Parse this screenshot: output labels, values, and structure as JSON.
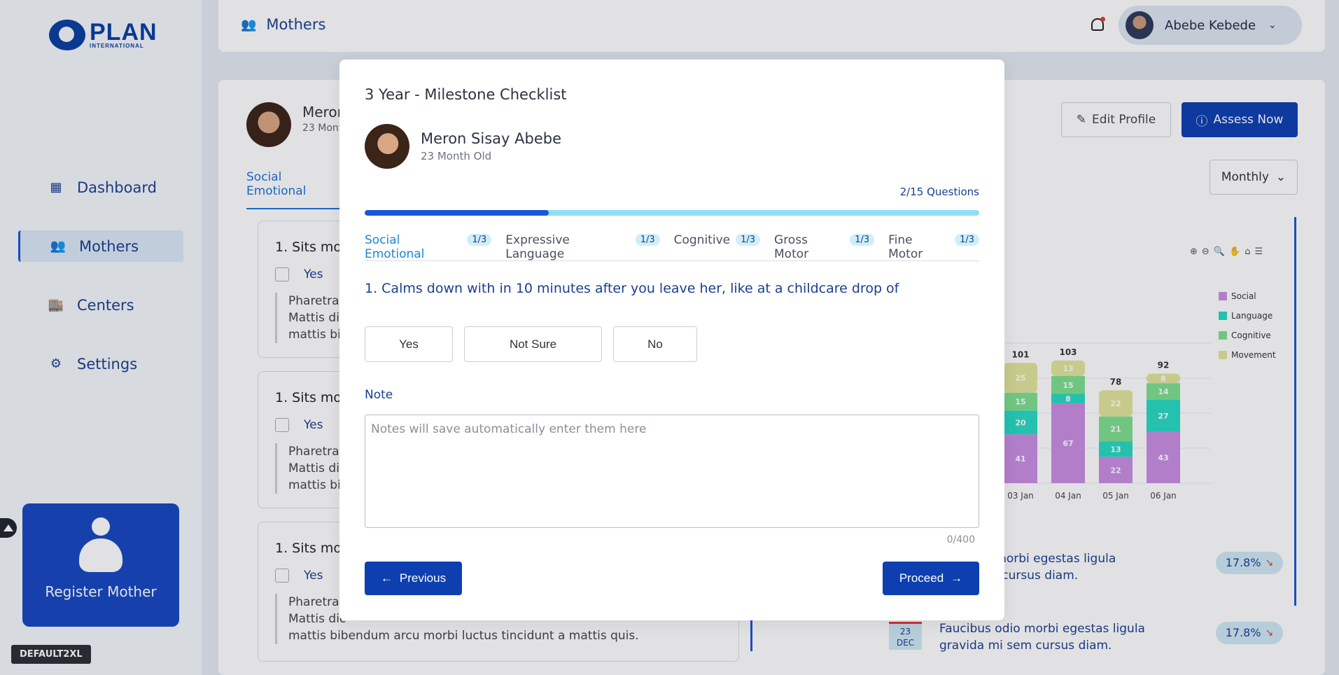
{
  "sidebar": {
    "logo": {
      "word": "PLAN",
      "sub": "INTERNATIONAL"
    },
    "items": [
      {
        "label": "Dashboard",
        "icon": "dashboard-icon"
      },
      {
        "label": "Mothers",
        "icon": "mothers-icon",
        "active": true
      },
      {
        "label": "Centers",
        "icon": "centers-icon"
      },
      {
        "label": "Settings",
        "icon": "gear-icon"
      }
    ],
    "register_label": "Register Mother",
    "env_tag": "DEFAULT2XL"
  },
  "header": {
    "title": "Mothers",
    "user_name": "Abebe Kebede"
  },
  "background": {
    "child_name": "Meron",
    "child_age": "23 Month",
    "active_tab": "Social Emotional",
    "questions": [
      {
        "title": "1. Sits mom",
        "yes": "Yes",
        "note": "Pharetra\nMattis dic\nmattis bil"
      },
      {
        "title": "1. Sits mom",
        "yes": "Yes",
        "note": "Pharetra\nMattis dic\nmattis bil"
      },
      {
        "title": "1. Sits mom",
        "yes": "Yes",
        "note": "Pharetra\nMattis dic\nmattis bibendum arcu morbi luctus tincidunt a mattis quis."
      }
    ],
    "edit_profile_label": "Edit Profile",
    "assess_now_label": "Assess Now",
    "period_select": "Monthly",
    "stats": [
      {
        "text": "Faucibus odio morbi egestas ligula gravida mi sem cursus diam.",
        "visible_text": "dio morbi egestas ligula\nsem cursus diam.",
        "value": "17.8%"
      },
      {
        "text": "Faucibus odio morbi egestas ligula\ngravida mi sem cursus diam.",
        "value": "17.8%",
        "date_day": "23",
        "date_month": "DEC"
      }
    ]
  },
  "chart_data": {
    "type": "bar",
    "stacked": true,
    "categories": [
      "03 Jan",
      "04 Jan",
      "05 Jan",
      "06 Jan"
    ],
    "totals": [
      101,
      103,
      78,
      92
    ],
    "series": [
      {
        "name": "Social",
        "color": "#c98ee3",
        "values": [
          41,
          67,
          22,
          43
        ]
      },
      {
        "name": "Language",
        "color": "#27dbc4",
        "values": [
          20,
          8,
          13,
          27
        ]
      },
      {
        "name": "Cognitive",
        "color": "#7ee08f",
        "values": [
          15,
          15,
          21,
          14
        ]
      },
      {
        "name": "Movement",
        "color": "#e3e59a",
        "values": [
          25,
          13,
          22,
          8
        ]
      }
    ]
  },
  "modal": {
    "title": "3 Year - Milestone Checklist",
    "child_name": "Meron Sisay Abebe",
    "child_age": "23 Month Old",
    "question_count": "2/15 Questions",
    "progress": 0.3,
    "tabs": [
      {
        "label": "Social Emotional",
        "count": "1/3",
        "active": true
      },
      {
        "label": "Expressive Language",
        "count": "1/3"
      },
      {
        "label": "Cognitive",
        "count": "1/3"
      },
      {
        "label": "Gross Motor",
        "count": "1/3"
      },
      {
        "label": "Fine Motor",
        "count": "1/3"
      }
    ],
    "question": "1. Calms down with in 10 minutes after you leave her, like at a childcare drop of",
    "options": [
      "Yes",
      "Not Sure",
      "No"
    ],
    "note_label": "Note",
    "note_placeholder": "Notes will save automatically enter them here",
    "char_counter": "0/400",
    "previous_label": "Previous",
    "proceed_label": "Proceed"
  }
}
